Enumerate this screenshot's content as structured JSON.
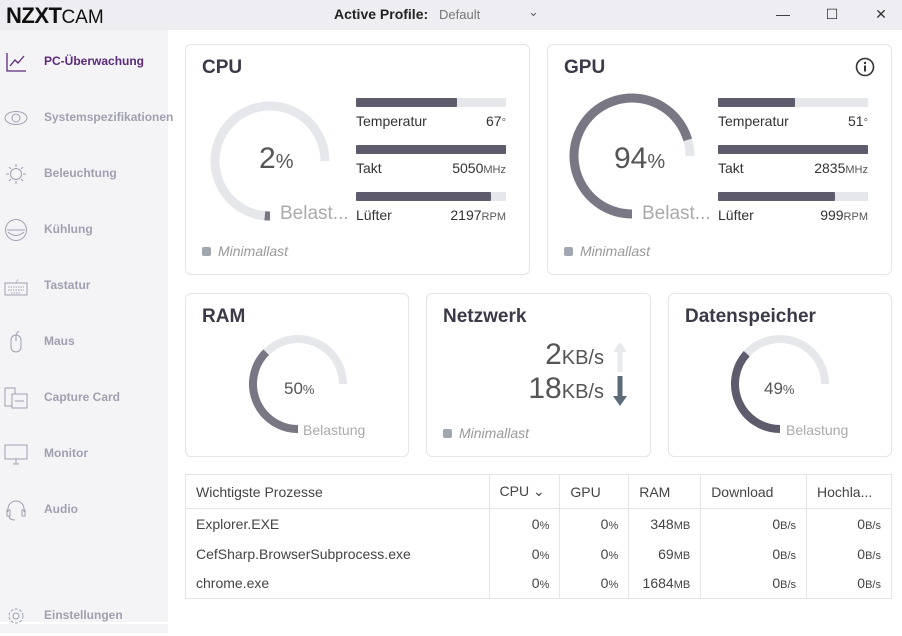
{
  "app": {
    "logo": "NZXT",
    "logo_suffix": "CAM",
    "profile_label": "Active Profile:",
    "profile_value": "Default"
  },
  "window": {
    "minimize": "—",
    "maximize": "☐",
    "close": "✕"
  },
  "sidebar": {
    "items": [
      {
        "label": "PC-Überwachung",
        "icon": "chart-line-icon",
        "active": true
      },
      {
        "label": "Systemspezifikationen",
        "icon": "eye-icon"
      },
      {
        "label": "Beleuchtung",
        "icon": "sun-icon"
      },
      {
        "label": "Kühlung",
        "icon": "cooler-icon"
      },
      {
        "label": "Tastatur",
        "icon": "keyboard-icon"
      },
      {
        "label": "Maus",
        "icon": "mouse-icon"
      },
      {
        "label": "Capture Card",
        "icon": "capture-card-icon"
      },
      {
        "label": "Monitor",
        "icon": "monitor-icon"
      },
      {
        "label": "Audio",
        "icon": "headset-icon"
      }
    ],
    "settings": "Einstellungen"
  },
  "colors": {
    "accent": "#5a2a7a",
    "gauge_fill": "#5e5b6d",
    "gauge_track": "#e6e7eb"
  },
  "cpu": {
    "title": "CPU",
    "load": 2,
    "load_unit": "%",
    "load_label": "Belast...",
    "status": "Minimallast",
    "metrics": [
      {
        "label": "Temperatur",
        "value": "67",
        "unit": "°",
        "fill": 0.67
      },
      {
        "label": "Takt",
        "value": "5050",
        "unit": "MHz",
        "fill": 1.0
      },
      {
        "label": "Lüfter",
        "value": "2197",
        "unit": "RPM",
        "fill": 0.9
      }
    ]
  },
  "gpu": {
    "title": "GPU",
    "load": 94,
    "load_unit": "%",
    "load_label": "Belast...",
    "status": "Minimallast",
    "info_icon": "info-icon",
    "metrics": [
      {
        "label": "Temperatur",
        "value": "51",
        "unit": "°",
        "fill": 0.51
      },
      {
        "label": "Takt",
        "value": "2835",
        "unit": "MHz",
        "fill": 1.0
      },
      {
        "label": "Lüfter",
        "value": "999",
        "unit": "RPM",
        "fill": 0.78
      }
    ]
  },
  "ram": {
    "title": "RAM",
    "load": 50,
    "load_unit": "%",
    "load_label": "Belastung"
  },
  "network": {
    "title": "Netzwerk",
    "upload": "2",
    "upload_unit": "KB/s",
    "download": "18",
    "download_unit": "KB/s",
    "status": "Minimallast"
  },
  "storage": {
    "title": "Datenspeicher",
    "load": 49,
    "load_unit": "%",
    "load_label": "Belastung"
  },
  "processes": {
    "headers": [
      "Wichtigste Prozesse",
      "CPU",
      "GPU",
      "RAM",
      "Download",
      "Hochla..."
    ],
    "rows": [
      [
        "Explorer.EXE",
        "0",
        "0",
        "348",
        "0",
        "0"
      ],
      [
        "CefSharp.BrowserSubprocess.exe",
        "0",
        "0",
        "69",
        "0",
        "0"
      ],
      [
        "chrome.exe",
        "0",
        "0",
        "1684",
        "0",
        "0"
      ]
    ],
    "units": [
      "%",
      "%",
      "MB",
      "B/s",
      "B/s"
    ]
  }
}
